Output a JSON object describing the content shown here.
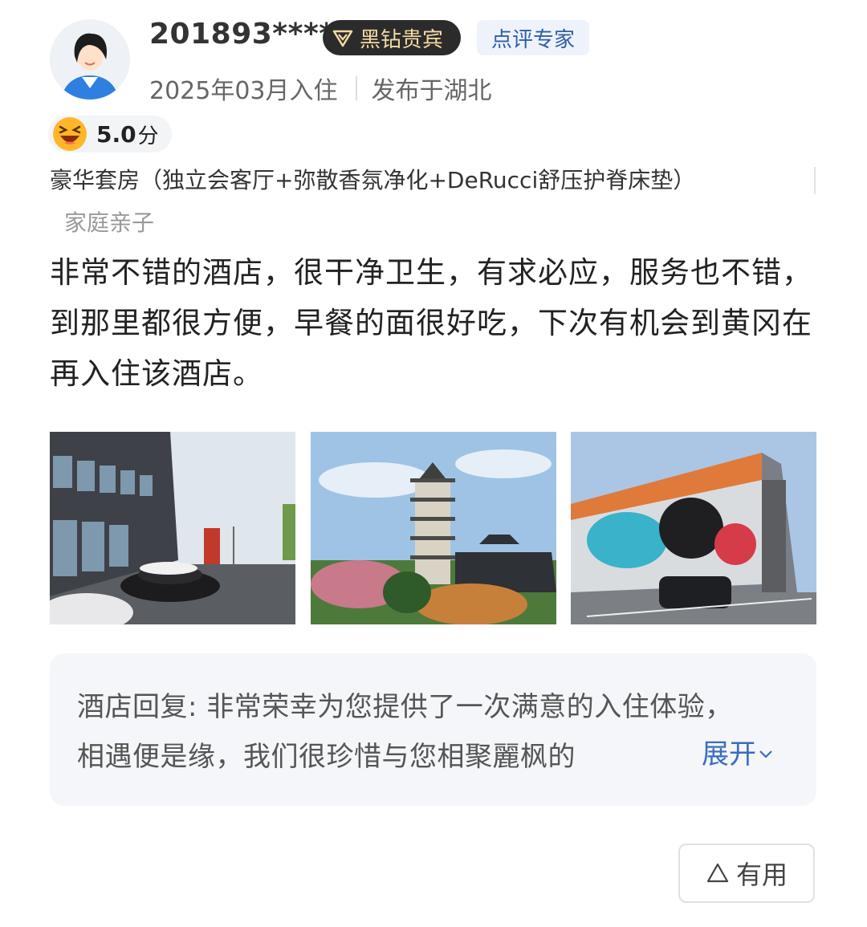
{
  "user": {
    "name": "201893****",
    "vip_label": "黑钻贵宾",
    "expert_label": "点评专家",
    "stay_date": "2025年03月入住",
    "location": "发布于湖北"
  },
  "rating": {
    "score": "5.0",
    "unit": "分"
  },
  "room": {
    "name": "豪华套房（独立会客厅+弥散香氛净化+DeRucci舒压护脊床垫）",
    "trip_type": "家庭亲子"
  },
  "review": {
    "text": "非常不错的酒店，很干净卫生，有求必应，服务也不错，到那里都很方便，早餐的面很好吃，下次有机会到黄冈在再入住该酒店。"
  },
  "photos": [
    "hotel-exterior-photo",
    "pagoda-photo",
    "graffiti-wall-photo"
  ],
  "reply": {
    "text": "酒店回复: 非常荣幸为您提供了一次满意的入住体验，相遇便是缘，我们很珍惜与您相聚麗枫的",
    "expand_label": "展开"
  },
  "helpful": {
    "label": "有用"
  },
  "colors": {
    "vip_bg": "#2b2b2b",
    "vip_text": "#f3d9a3",
    "expert_text": "#2d5ea8",
    "link": "#3a6cc0"
  }
}
